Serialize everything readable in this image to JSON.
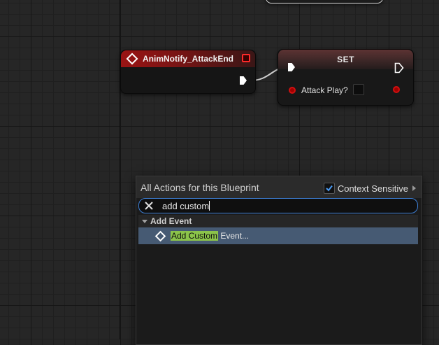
{
  "nodes": {
    "anim_notify": {
      "title": "AnimNotify_AttackEnd"
    },
    "set": {
      "title": "SET",
      "variable_label": "Attack Play?",
      "variable_value": false
    }
  },
  "action_menu": {
    "title": "All Actions for this Blueprint",
    "context_sensitive_label": "Context Sensitive",
    "context_sensitive_checked": true,
    "search_value": "add custom",
    "categories": [
      {
        "label": "Add Event",
        "expanded": true,
        "items": [
          {
            "match_text": "Add Custom",
            "rest_text": " Event...",
            "selected": true,
            "icon": "event-icon"
          }
        ]
      }
    ]
  },
  "colors": {
    "event_header": "#9a1414",
    "set_header": "#5c3333",
    "bool_pin": "#d01010",
    "search_focus": "#3d7fd6",
    "selected_row": "#465a73",
    "match_highlight": "#8bc34a"
  }
}
